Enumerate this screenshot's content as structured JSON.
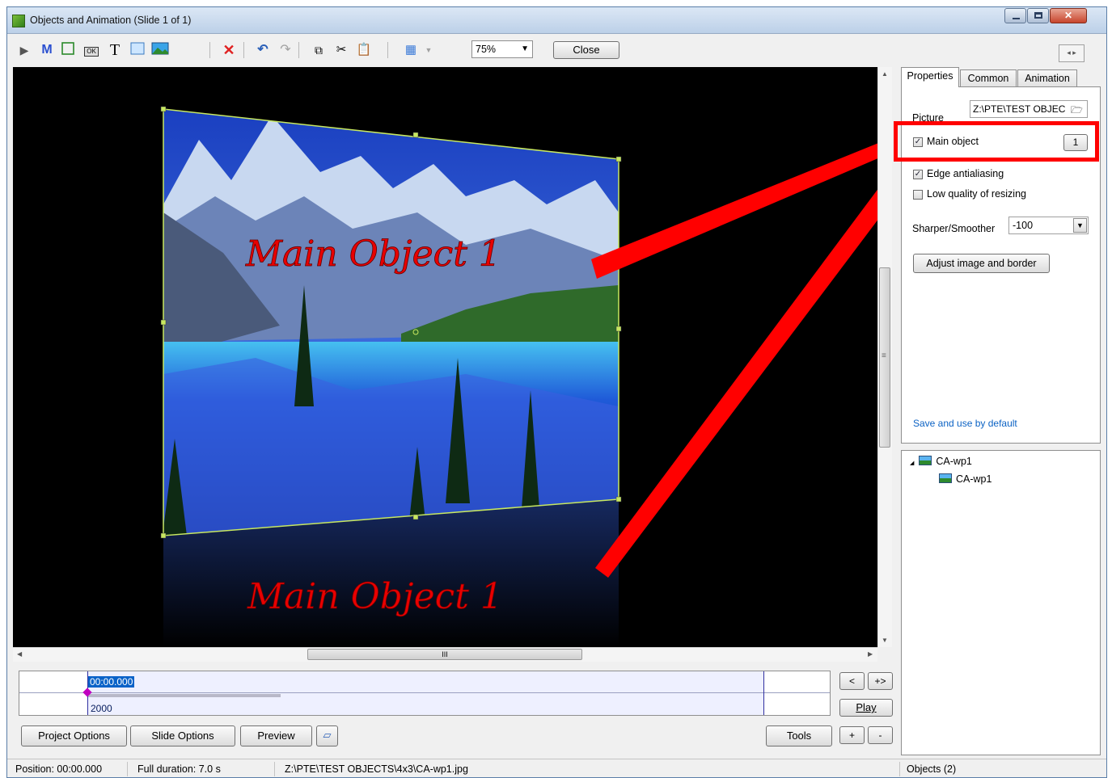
{
  "window": {
    "title": "Objects and Animation  (Slide 1 of 1)"
  },
  "toolbar": {
    "zoom": "75%",
    "close_label": "Close",
    "m_label": "M",
    "t_label": "T",
    "ok_label": "OK"
  },
  "canvas": {
    "annotation_top": "Main Object 1",
    "annotation_bottom": "Main Object 1",
    "hscroll_grip": "III",
    "vscroll_grip": "≡"
  },
  "timeline": {
    "current_time": "00:00.000",
    "duration_value": "2000"
  },
  "buttons": {
    "project_options": "Project Options",
    "slide_options": "Slide Options",
    "preview": "Preview",
    "tools": "Tools",
    "play": "Play",
    "prev": "<",
    "next": "+>",
    "plus": "+",
    "minus": "-"
  },
  "status": {
    "position": "Position: 00:00.000",
    "full_duration": "Full duration: 7.0 s",
    "file_path": "Z:\\PTE\\TEST OBJECTS\\4x3\\CA-wp1.jpg",
    "objects": "Objects (2)"
  },
  "properties": {
    "tabs": [
      "Properties",
      "Common",
      "Animation"
    ],
    "picture_label": "Picture",
    "picture_value": "Z:\\PTE\\TEST OBJEC",
    "main_object_label": "Main object",
    "main_object_checked": true,
    "main_object_number": "1",
    "edge_antialiasing_label": "Edge antialiasing",
    "edge_antialiasing_checked": true,
    "low_quality_label": "Low quality of resizing",
    "low_quality_checked": false,
    "sharper_label": "Sharper/Smoother",
    "sharper_value": "-100",
    "adjust_button": "Adjust image and border",
    "save_default_link": "Save and use by default"
  },
  "tree": {
    "parent": "CA-wp1",
    "child": "CA-wp1",
    "expander": "◢"
  },
  "colors": {
    "accent_red": "#ff0000",
    "link_blue": "#0b62c4",
    "frame_green": "#c8e860"
  }
}
